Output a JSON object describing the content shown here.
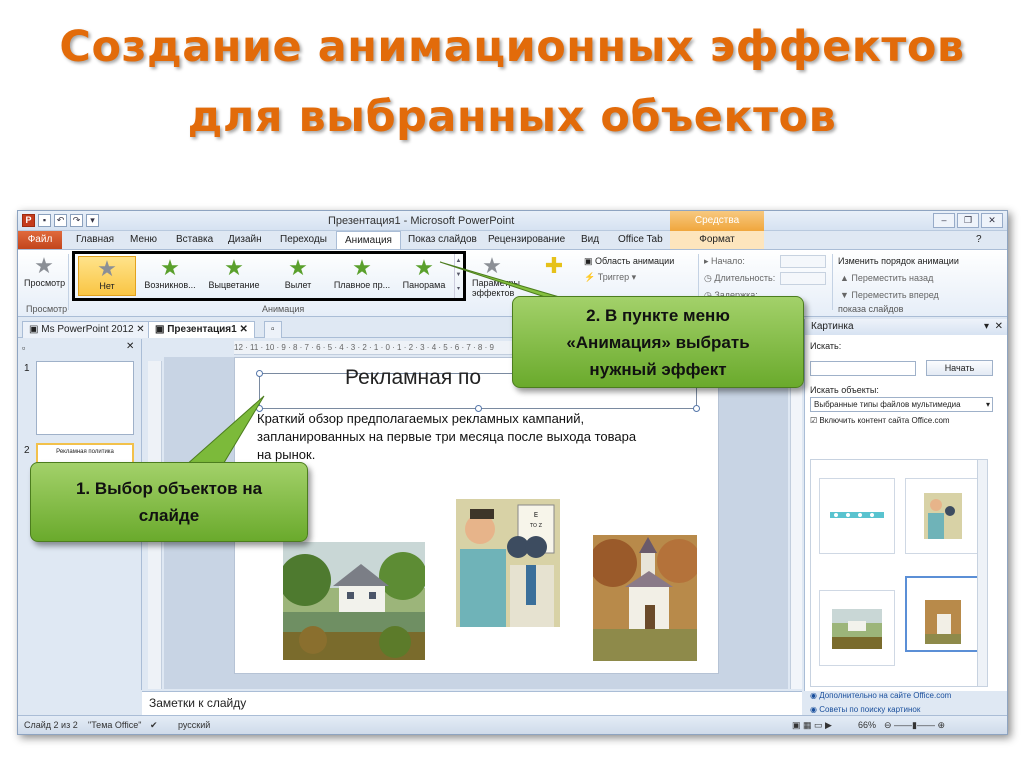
{
  "title": {
    "line1": "Создание анимационных эффектов",
    "line2": "для выбранных объектов"
  },
  "window": {
    "title": "Презентация1 - Microsoft PowerPoint",
    "context_tab": "Средства рисования"
  },
  "ribbon_tabs": [
    "Файл",
    "Главная",
    "Меню",
    "Вставка",
    "Дизайн",
    "Переходы",
    "Анимация",
    "Показ слайдов",
    "Рецензирование",
    "Вид",
    "Office Tab",
    "Формат"
  ],
  "ribbon": {
    "preview": "Просмотр",
    "preview_group": "Просмотр",
    "animation_group": "Анимация",
    "effects": [
      "Нет",
      "Возникнов...",
      "Выцветание",
      "Вылет",
      "Плавное пр...",
      "Панорама"
    ],
    "params": "Параметры",
    "params2": "эффектов",
    "anim_area": "Область анимации",
    "trigger": "Триггер",
    "start": "Начало:",
    "duration": "Длительность:",
    "delay": "Задержка:",
    "reorder_title": "Изменить порядок анимации",
    "move_back": "Переместить назад",
    "move_forward": "Переместить вперед",
    "timing_group": "показа слайдов"
  },
  "doc_tabs": [
    "Ms PowerPoint 2012",
    "Презентация1"
  ],
  "slides": {
    "thumb1_num": "1",
    "thumb2_num": "2",
    "thumb2_text": "Рекламная политика"
  },
  "ruler": "12 · 11 · 10 · 9 · 8 · 7 · 6 · 5 · 4 · 3 · 2 · 1 · 0 · 1 · 2 · 3 · 4 · 5 · 6 · 7 · 8 · 9",
  "slide": {
    "title": "Рекламная по",
    "body_line1": "Краткий обзор предполагаемых рекламных кампаний,",
    "body_line2": "запланированных на первые три месяца после выхода товара",
    "body_line3": "на рынок."
  },
  "clipart": {
    "header": "Картинка",
    "search_label": "Искать:",
    "go": "Начать",
    "search_objects": "Искать объекты:",
    "media_types": "Выбранные типы файлов мультимедиа",
    "include_office": "Включить контент сайта Office.com",
    "more_link": "Дополнительно на сайте Office.com",
    "tips_link": "Советы по поиску картинок"
  },
  "notes": "Заметки к слайду",
  "status": {
    "slide": "Слайд 2 из 2",
    "theme": "\"Тема Office\"",
    "lang": "русский",
    "zoom": "66%"
  },
  "callouts": {
    "select_line1": "1. Выбор объектов на",
    "select_line2": "слайде",
    "menu_line1": "2. В пункте меню",
    "menu_line2": "«Анимация» выбрать",
    "menu_line3": "нужный эффект"
  },
  "colors": {
    "title": "#e26b0a",
    "callout": "#7cba3a",
    "selected_effect": "#f9c544"
  }
}
